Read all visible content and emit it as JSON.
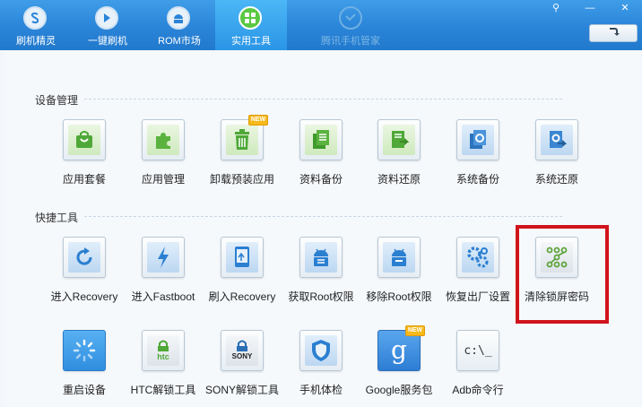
{
  "nav": {
    "items": [
      {
        "label": "刷机精灵",
        "icon": "app-logo-icon"
      },
      {
        "label": "一键刷机",
        "icon": "one-click-flash-icon"
      },
      {
        "label": "ROM市场",
        "icon": "android-market-icon"
      },
      {
        "label": "实用工具",
        "icon": "toolbox-grid-icon"
      },
      {
        "label": "腾讯手机管家",
        "icon": "shield-check-icon"
      }
    ],
    "active_index": 3
  },
  "window": {
    "pin_glyph": "⚲",
    "minimize_glyph": "—",
    "close_glyph": "✕",
    "refresh_icon": "refresh-arrow-icon"
  },
  "sections": {
    "device": {
      "title": "设备管理",
      "tools": [
        {
          "label": "应用套餐",
          "icon": "shopping-bag-icon"
        },
        {
          "label": "应用管理",
          "icon": "puzzle-icon"
        },
        {
          "label": "卸载预装应用",
          "icon": "trash-icon",
          "badge": "NEW"
        },
        {
          "label": "资料备份",
          "icon": "document-backup-icon"
        },
        {
          "label": "资料还原",
          "icon": "document-restore-icon"
        },
        {
          "label": "系统备份",
          "icon": "system-backup-icon"
        },
        {
          "label": "系统还原",
          "icon": "system-restore-icon"
        }
      ]
    },
    "quick": {
      "title": "快捷工具",
      "tools": [
        {
          "label": "进入Recovery",
          "icon": "refresh-icon"
        },
        {
          "label": "进入Fastboot",
          "icon": "lightning-icon"
        },
        {
          "label": "刷入Recovery",
          "icon": "tablet-icon"
        },
        {
          "label": "获取Root权限",
          "icon": "android-root-icon"
        },
        {
          "label": "移除Root权限",
          "icon": "android-unroot-icon"
        },
        {
          "label": "恢复出厂设置",
          "icon": "gears-icon"
        },
        {
          "label": "清除锁屏密码",
          "icon": "pattern-lock-icon"
        },
        {
          "label": "重启设备",
          "icon": "restart-spinner-icon"
        },
        {
          "label": "HTC解锁工具",
          "icon": "htc-unlock-icon",
          "brand": "htc"
        },
        {
          "label": "SONY解锁工具",
          "icon": "sony-unlock-icon",
          "brand": "SONY"
        },
        {
          "label": "手机体检",
          "icon": "shield-icon"
        },
        {
          "label": "Google服务包",
          "icon": "google-icon",
          "badge": "NEW",
          "glyph": "g"
        },
        {
          "label": "Adb命令行",
          "icon": "terminal-icon",
          "glyph": "c:\\_"
        }
      ]
    }
  },
  "colors": {
    "topbar": "#2a84d8",
    "active_tab": "#3aa6ee",
    "highlight": "#d0141b",
    "badge": "#f6b91b"
  }
}
